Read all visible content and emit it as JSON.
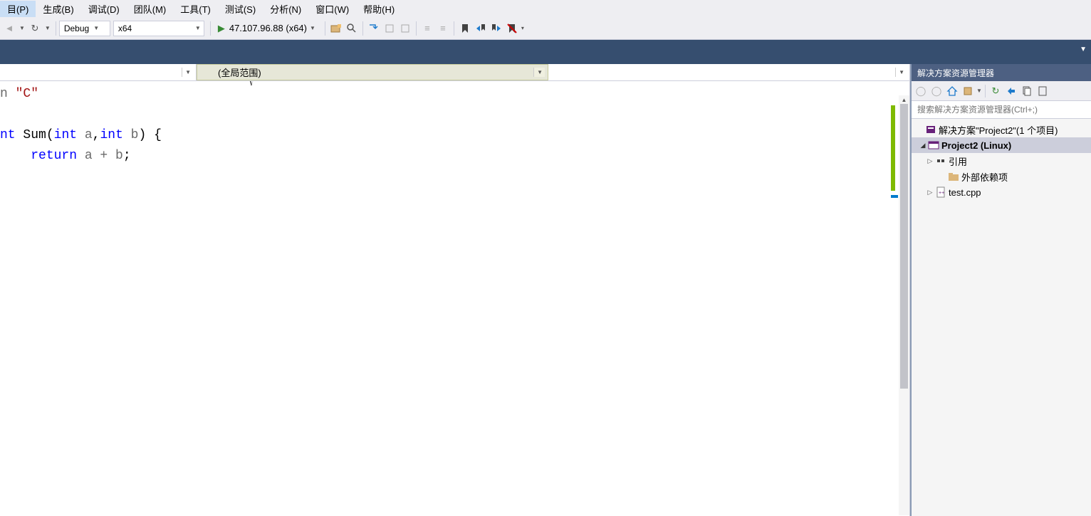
{
  "menu": {
    "items": [
      "目(P)",
      "生成(B)",
      "调试(D)",
      "团队(M)",
      "工具(T)",
      "测试(S)",
      "分析(N)",
      "窗口(W)",
      "帮助(H)"
    ]
  },
  "toolbar": {
    "config": "Debug",
    "platform": "x64",
    "run_target": "47.107.96.88 (x64)"
  },
  "navbar": {
    "left": "",
    "middle": "(全局范围)",
    "right": ""
  },
  "code": {
    "line1_prefix": "n ",
    "line1_str": "\"C\"",
    "line2_kw1": "nt",
    "line2_func": " Sum",
    "line2_p1": "(",
    "line2_kw2": "int",
    "line2_a": " a",
    "line2_c1": ",",
    "line2_kw3": "int",
    "line2_b": " b",
    "line2_p2": ") {",
    "line3_indent": "    ",
    "line3_kw": "return",
    "line3_expr": " a + b",
    "line3_semi": ";"
  },
  "solution": {
    "title": "解决方案资源管理器",
    "search_placeholder": "搜索解决方案资源管理器(Ctrl+;)",
    "root": "解决方案\"Project2\"(1 个项目)",
    "project": "Project2 (Linux)",
    "references": "引用",
    "external": "外部依赖项",
    "file": "test.cpp"
  }
}
